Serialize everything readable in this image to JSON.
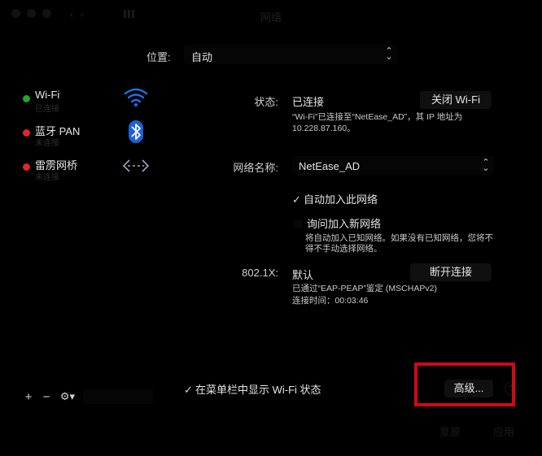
{
  "window": {
    "title": "网络"
  },
  "location": {
    "label": "位置:",
    "value": "自动"
  },
  "services": [
    {
      "name": "Wi-Fi",
      "status": "已连接",
      "dot_color": "#1fa82a",
      "icon": "wifi-icon"
    },
    {
      "name": "蓝牙 PAN",
      "status": "未连接",
      "dot_color": "#e0262a",
      "icon": "bluetooth-icon"
    },
    {
      "name": "雷雳网桥",
      "status": "未连接",
      "dot_color": "#e0262a",
      "icon": "thunderbolt-bridge-icon"
    }
  ],
  "status": {
    "label": "状态:",
    "value": "已连接",
    "toggle_button": "关闭 Wi-Fi",
    "detail_line1": "“Wi-Fi”已连接至“NetEase_AD”，其 IP 地址为",
    "detail_line2": "10.228.87.160。"
  },
  "network_name": {
    "label": "网络名称:",
    "value": "NetEase_AD"
  },
  "options": {
    "auto_join": {
      "label": "自动加入此网络",
      "checked": true
    },
    "ask_join": {
      "label": "询问加入新网络",
      "checked": false
    },
    "ask_join_help_line1": "将自动加入已知网络。如果没有已知网络，您将不",
    "ask_join_help_line2": "得不手动选择网络。"
  },
  "dot1x": {
    "label": "802.1X:",
    "value": "默认",
    "disconnect_button": "断开连接",
    "auth_line": "已通过“EAP-PEAP”鉴定 (MSCHAPv2)",
    "time_line": "连接时间：00:03:46"
  },
  "show_in_menubar": {
    "label": "在菜单栏中显示 Wi-Fi 状态",
    "checked": true
  },
  "advanced_button": "高级...",
  "help_label": "?",
  "bottom_tools": {
    "add": "+",
    "remove": "−",
    "gear": "⚙▾"
  },
  "footer": {
    "revert": "复原",
    "apply": "应用"
  },
  "colors": {
    "highlight": "#d0081a",
    "wifi_blue": "#1f6fe0"
  }
}
